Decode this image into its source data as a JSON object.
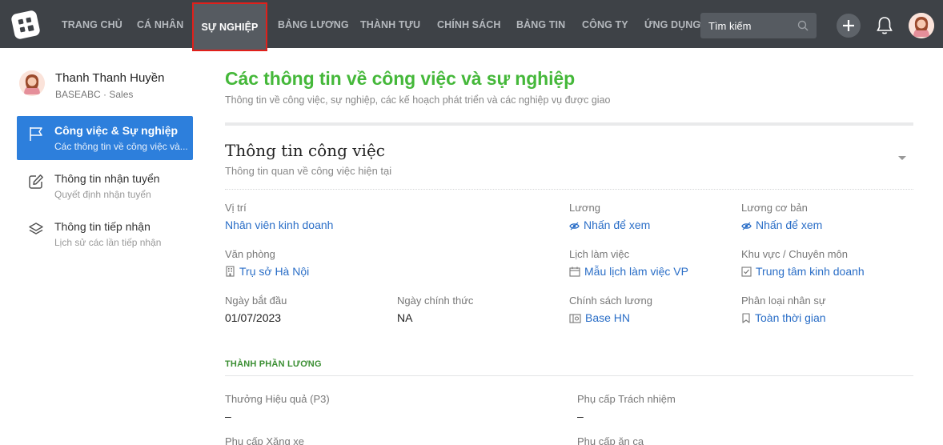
{
  "nav": {
    "items": [
      "TRANG CHỦ",
      "CÁ NHÂN",
      "SỰ NGHIỆP",
      "BẢNG LƯƠNG",
      "THÀNH TỰU",
      "CHÍNH SÁCH",
      "BẢNG TIN",
      "CÔNG TY",
      "ỨNG DỤNG"
    ],
    "active": "SỰ NGHIỆP",
    "search_placeholder": "Tìm kiếm",
    "icons": [
      "logo-icon",
      "chevron-down-icon",
      "search-icon",
      "plus-icon",
      "bell-icon",
      "avatar"
    ]
  },
  "profile": {
    "name": "Thanh Thanh Huyền",
    "subtitle": "BASEABC · Sales"
  },
  "sidebar": {
    "items": [
      {
        "title": "Công việc & Sự nghiệp",
        "subtitle": "Các thông tin về công việc và...",
        "icon": "flag-icon",
        "active": true
      },
      {
        "title": "Thông tin nhận tuyển",
        "subtitle": "Quyết định nhận tuyển",
        "icon": "edit-icon",
        "active": false
      },
      {
        "title": "Thông tin tiếp nhận",
        "subtitle": "Lịch sử các lần tiếp nhận",
        "icon": "layers-icon",
        "active": false
      }
    ]
  },
  "page": {
    "title": "Các thông tin về công việc và sự nghiệp",
    "subtitle": "Thông tin về công việc, sự nghiệp, các kế hoạch phát triển và các nghiệp vụ được giao"
  },
  "section": {
    "title": "Thông tin công việc",
    "subtitle": "Thông tin quan về công việc hiện tại",
    "fields": {
      "position": {
        "label": "Vị trí",
        "value": "Nhân viên kinh doanh"
      },
      "salary": {
        "label": "Lương",
        "value": "Nhấn để xem"
      },
      "base_salary": {
        "label": "Lương cơ bản",
        "value": "Nhấn để xem"
      },
      "office": {
        "label": "Văn phòng",
        "value": "Trụ sở Hà Nội"
      },
      "schedule": {
        "label": "Lịch làm việc",
        "value": "Mẫu lịch làm việc VP"
      },
      "area": {
        "label": "Khu vực / Chuyên môn",
        "value": "Trung tâm kinh doanh"
      },
      "start_date": {
        "label": "Ngày bắt đầu",
        "value": "01/07/2023"
      },
      "official_date": {
        "label": "Ngày chính thức",
        "value": "NA"
      },
      "salary_policy": {
        "label": "Chính sách lương",
        "value": "Base HN"
      },
      "staff_type": {
        "label": "Phân loại nhân sự",
        "value": "Toàn thời gian"
      }
    }
  },
  "salary_components": {
    "title": "THÀNH PHẦN LƯƠNG",
    "items": [
      {
        "label": "Thưởng Hiệu quả (P3)",
        "value": "–"
      },
      {
        "label": "Phụ cấp Trách nhiệm",
        "value": "–"
      },
      {
        "label": "Phụ cấp Xăng xe",
        "value": ""
      },
      {
        "label": "Phụ cấp ăn ca",
        "value": ""
      }
    ]
  },
  "colors": {
    "nav_bg": "#3e4247",
    "accent_green": "#45b83a",
    "link_blue": "#2a6ec7",
    "active_blue": "#2d7fdc",
    "highlight_red": "#e0201b"
  }
}
